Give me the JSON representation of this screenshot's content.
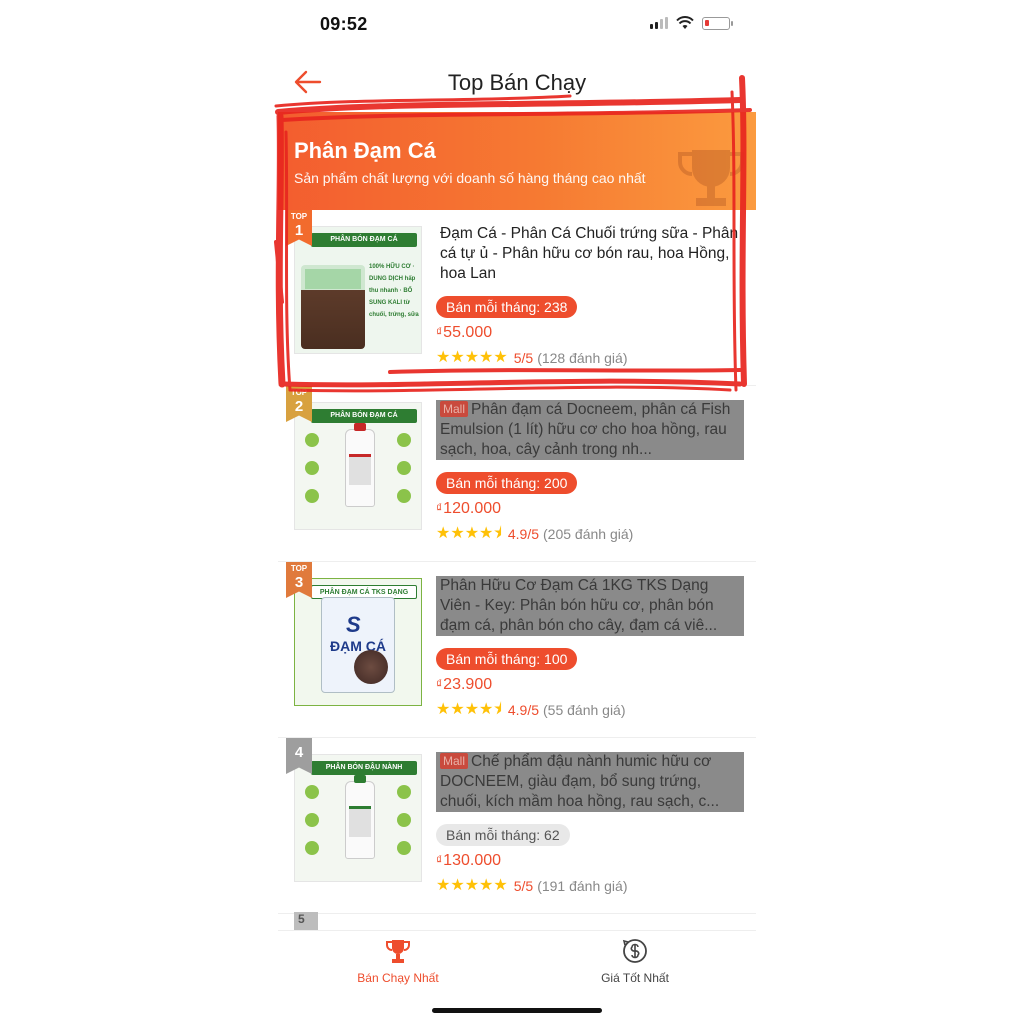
{
  "status_bar": {
    "time": "09:52"
  },
  "header": {
    "title": "Top Bán Chạy"
  },
  "banner": {
    "title": "Phân Đạm Cá",
    "subtitle": "Sản phẩm chất lượng với doanh số hàng tháng cao nhất"
  },
  "products": [
    {
      "rank": "1",
      "badge_top": "TOP",
      "thumb_label": "PHÂN BÓN ĐẠM CÁ",
      "thumb_notes": "100% HỮU CƠ · DUNG DỊCH hấp thu nhanh · BỔ SUNG KALI từ chuối, trứng, sữa",
      "title": "Đạm Cá - Phân Cá Chuối trứng sữa - Phân cá tự ủ - Phân hữu cơ bón rau, hoa Hồng, hoa Lan",
      "mall": "",
      "sales": "Bán mỗi tháng: 238",
      "price_currency": "₫",
      "price": "55.000",
      "stars": "★★★★★",
      "rating": "5/5",
      "reviews": "(128 đánh giá)"
    },
    {
      "rank": "2",
      "badge_top": "TOP",
      "thumb_label": "PHÂN BÓN ĐẠM CÁ",
      "mall": "Mall",
      "title": "Phân đạm cá Docneem, phân cá Fish Emulsion (1 lít)  hữu cơ cho hoa hồng, rau sạch, hoa, cây cảnh trong nh...",
      "sales": "Bán mỗi tháng: 200",
      "price_currency": "₫",
      "price": "120.000",
      "stars": "★★★★⯨",
      "rating": "4.9/5",
      "reviews": "(205 đánh giá)"
    },
    {
      "rank": "3",
      "badge_top": "TOP",
      "thumb_label": "PHÂN ĐẠM CÁ TKS DẠNG VIÊN",
      "thumb_brand": "ĐẠM CÁ",
      "mall": "",
      "title": "Phân Hữu Cơ Đạm Cá 1KG TKS Dạng Viên - Key: Phân bón hữu cơ, phân bón đạm cá, phân bón cho cây, đạm cá viê...",
      "sales": "Bán mỗi tháng: 100",
      "price_currency": "₫",
      "price": "23.900",
      "stars": "★★★★⯨",
      "rating": "4.9/5",
      "reviews": "(55 đánh giá)"
    },
    {
      "rank": "4",
      "badge_top": "",
      "thumb_label": "PHÂN BÓN ĐẬU NÀNH",
      "mall": "Mall",
      "title": "Chế phẩm đậu nành humic hữu cơ DOCNEEM, giàu đạm, bổ sung trứng, chuối, kích mầm hoa hồng, rau sạch, c...",
      "sales": "Bán mỗi tháng: 62",
      "price_currency": "₫",
      "price": "130.000",
      "stars": "★★★★★",
      "rating": "5/5",
      "reviews": "(191 đánh giá)"
    }
  ],
  "peek_rank": "5",
  "tabs": [
    {
      "label": "Bán Chạy Nhất",
      "icon": "trophy-icon",
      "active": true
    },
    {
      "label": "Giá Tốt Nhất",
      "icon": "price-tag-icon",
      "active": false
    }
  ],
  "colors": {
    "accent": "#ee4d2d",
    "banner_start": "#f35d2f",
    "banner_end": "#fb9b3f",
    "star": "#ffc107",
    "scribble": "#e8261f",
    "mask": "#8a8a8a"
  }
}
